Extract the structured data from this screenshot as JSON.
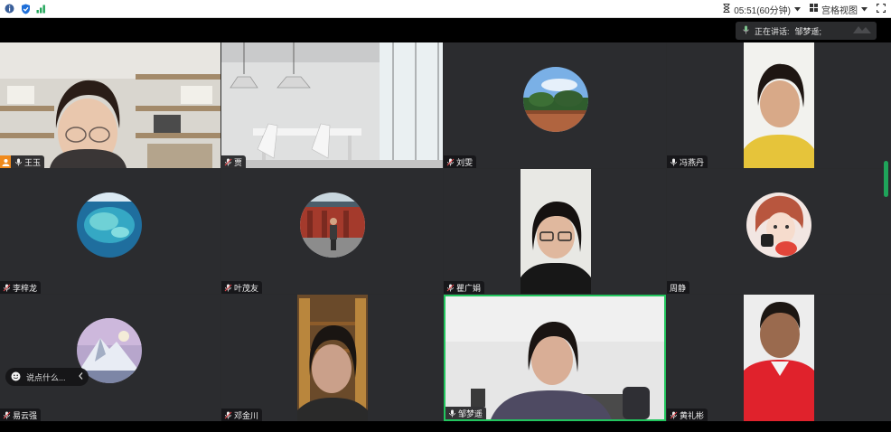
{
  "topbar": {
    "timer": "05:51(60分钟)",
    "view_label": "宫格视图"
  },
  "speaking": {
    "label": "正在讲话:",
    "name": "邹梦遥;"
  },
  "tiles": [
    {
      "name": "王玉"
    },
    {
      "name": "贾"
    },
    {
      "name": "刘雯"
    },
    {
      "name": "冯燕丹"
    },
    {
      "name": "李梓龙"
    },
    {
      "name": "叶茂友"
    },
    {
      "name": "瞿广娟"
    },
    {
      "name": "周静"
    },
    {
      "name": "易云强"
    },
    {
      "name": "邓金川"
    },
    {
      "name": "邹梦遥"
    },
    {
      "name": "黄礼彬"
    }
  ],
  "chat": {
    "placeholder": "说点什么..."
  },
  "colors": {
    "tile_bg": "#2b2c2f",
    "active_border": "#22c55e",
    "host_badge": "#f08a1c"
  },
  "icons": [
    "info-icon",
    "shield-icon",
    "signal-icon",
    "hourglass-icon",
    "grid-view-icon",
    "fullscreen-icon",
    "mic-icon",
    "host-icon",
    "emoji-icon",
    "chevron-left-icon"
  ]
}
